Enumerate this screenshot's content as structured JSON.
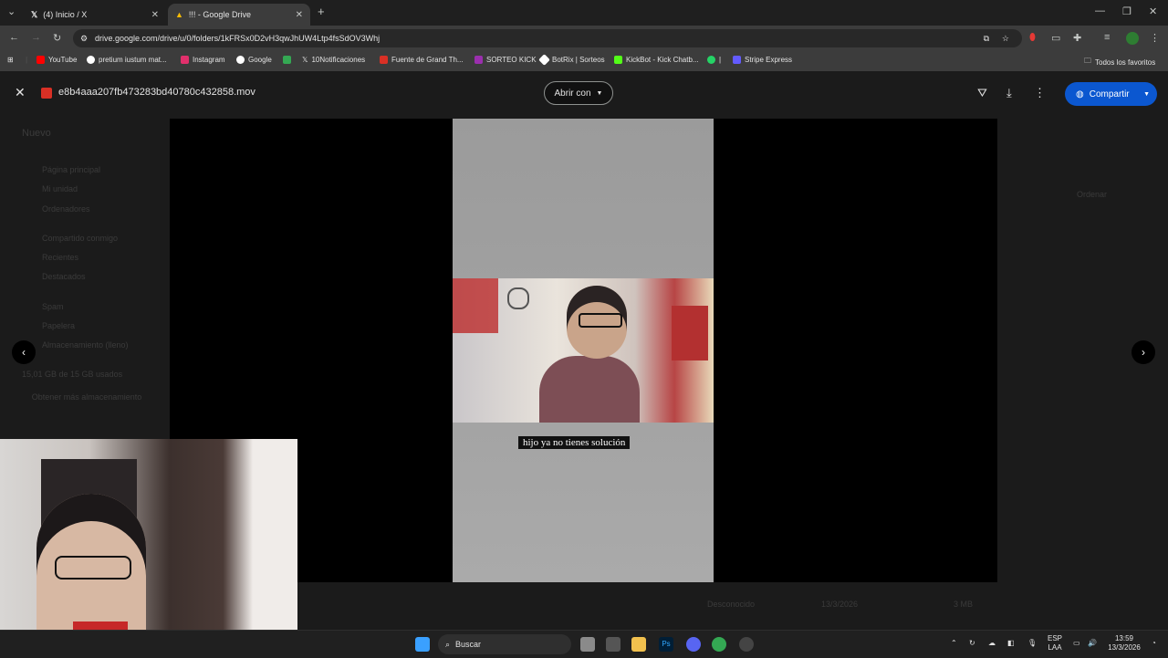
{
  "browser": {
    "tabs": [
      {
        "title": "(4) Inicio / X",
        "close": "✕"
      },
      {
        "title": "!!! - Google Drive",
        "close": "✕"
      }
    ],
    "new_tab": "+",
    "url": "drive.google.com/drive/u/0/folders/1kFRSx0D2vH3qwJhUW4Ltp4fsSdOV3Whj",
    "bookmarks": [
      {
        "label": "YouTube",
        "color": "#ff0000"
      },
      {
        "label": "pretium iustum mat...",
        "color": "#ffffff"
      },
      {
        "label": "Instagram",
        "color": "#e1306c"
      },
      {
        "label": "Google",
        "color": "#ffffff"
      },
      {
        "label": "",
        "color": "#34a853"
      },
      {
        "label": "10Notificaciones",
        "color": "#000000"
      },
      {
        "label": "Fuente de Grand Th...",
        "color": "#d93025"
      },
      {
        "label": "SORTEO KICK",
        "color": "#9b2fae"
      },
      {
        "label": "BotRix | Sorteos",
        "color": "#ffffff"
      },
      {
        "label": "KickBot - Kick Chatb...",
        "color": "#53fc18"
      },
      {
        "label": "|",
        "color": "#25d366"
      },
      {
        "label": "Stripe Express",
        "color": "#635bff"
      }
    ],
    "all_bookmarks": "Todos los favoritos"
  },
  "drive_bg": {
    "new_button": "Nuevo",
    "nav": [
      "Página principal",
      "Mi unidad",
      "Ordenadores",
      "Compartido conmigo",
      "Recientes",
      "Destacados",
      "Spam",
      "Papelera",
      "Almacenamiento (lleno)"
    ],
    "storage": "15,01 GB de 15 GB usados",
    "get_storage": "Obtener más almacenamiento",
    "sort": "Ordenar",
    "row_owner": "Desconocido",
    "row_date": "13/3/2026",
    "row_size": "3 MB"
  },
  "viewer": {
    "file_name": "e8b4aaa207fb473283bd40780c432858.mov",
    "open_with": "Abrir con",
    "share": "Compartir",
    "subtitle": "hijo ya no tienes solución",
    "prev": "‹",
    "next": "›"
  },
  "taskbar": {
    "search": "Buscar",
    "lang_top": "ESP",
    "lang_bottom": "LAA",
    "time": "13:59",
    "date": "13/3/2026"
  }
}
